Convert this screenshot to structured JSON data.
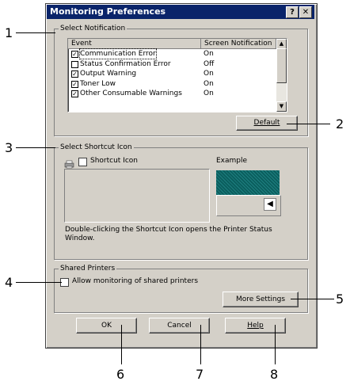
{
  "window": {
    "title": "Monitoring Preferences",
    "help_btn": "?",
    "close_btn": "✕"
  },
  "notification": {
    "group_label": "Select Notification",
    "col_event": "Event",
    "col_screen": "Screen Notification",
    "rows": [
      {
        "event": "Communication Error",
        "status": "On",
        "checked": true
      },
      {
        "event": "Status Confirmation Error",
        "status": "Off",
        "checked": false
      },
      {
        "event": "Output Warning",
        "status": "On",
        "checked": true
      },
      {
        "event": "Toner Low",
        "status": "On",
        "checked": true
      },
      {
        "event": "Other Consumable Warnings",
        "status": "On",
        "checked": true
      }
    ],
    "default_label": "Default"
  },
  "shortcut": {
    "group_label": "Select Shortcut Icon",
    "checkbox_label": "Shortcut Icon",
    "example_label": "Example",
    "description": "Double-clicking the Shortcut Icon opens the Printer Status Window."
  },
  "shared": {
    "group_label": "Shared Printers",
    "checkbox_label": "Allow monitoring of shared printers",
    "more_settings_label": "More Settings"
  },
  "buttons": {
    "ok": "OK",
    "cancel": "Cancel",
    "help": "Help"
  },
  "callouts": {
    "n1": "1",
    "n2": "2",
    "n3": "3",
    "n4": "4",
    "n5": "5",
    "n6": "6",
    "n7": "7",
    "n8": "8"
  }
}
